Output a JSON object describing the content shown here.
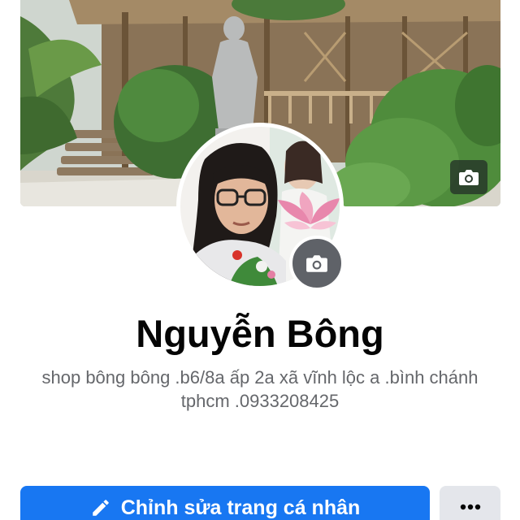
{
  "profile": {
    "name": "Nguyễn Bông",
    "bio": "shop bông bông .b6/8a ấp 2a xã vĩnh lộc a .bình chánh tphcm .0933208425"
  },
  "actions": {
    "edit_profile_label": "Chỉnh sửa trang cá nhân"
  },
  "icons": {
    "cover_camera": "camera-icon",
    "avatar_camera": "camera-icon",
    "edit": "pencil-icon",
    "more": "more-horizontal-icon"
  },
  "colors": {
    "primary": "#1877f2",
    "secondary_button": "#e4e6eb",
    "name_text": "#050505",
    "bio_text": "#65676b"
  }
}
